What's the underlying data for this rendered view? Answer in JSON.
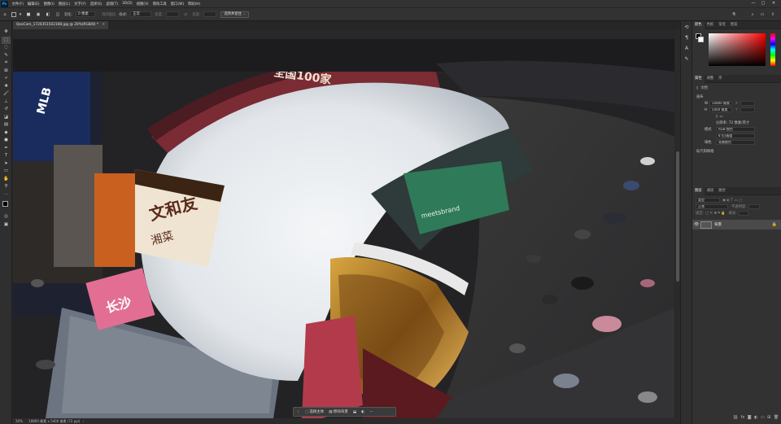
{
  "menubar": {
    "logo": "Ps",
    "items": [
      "文件(F)",
      "编辑(E)",
      "图像(I)",
      "图层(L)",
      "文字(Y)",
      "选择(S)",
      "滤镜(T)",
      "3D(D)",
      "视图(V)",
      "增效工具",
      "窗口(W)",
      "帮助(H)"
    ],
    "minimize": "—",
    "maximize": "□",
    "close": "✕"
  },
  "options": {
    "feather_label": "羽化:",
    "feather_value": "0 像素",
    "antialias_label": "消除锯齿",
    "style_label": "样式:",
    "style_value": "正常",
    "width_label": "宽度:",
    "height_label": "高度:",
    "select_subject_button": "选择并遮住 ..."
  },
  "document": {
    "tab_title": "QooCam_1720351502168.jpg @ 20%(RGB/8) *",
    "tab_close": "✕"
  },
  "status": {
    "zoom": "20%",
    "doc_info": "10800 像素 x 5400 像素 (72 ppi)",
    "arrow": "›"
  },
  "context_bar": {
    "select_subject": "选择主体",
    "remove_background": "移除背景",
    "more": "⋯"
  },
  "right_panel": {
    "color_tabs": [
      "颜色",
      "色板",
      "渐变",
      "图案"
    ],
    "properties_tabs": [
      "属性",
      "调整",
      "库"
    ],
    "doc_label": "文档",
    "canvas_section": "画布",
    "width_label": "W",
    "width_value": "10800 像素",
    "height_label": "H",
    "height_value": "5400 像素",
    "x_label": "X",
    "y_label": "Y",
    "resolution": "分辨率: 72 像素/英寸",
    "mode_label": "模式",
    "mode_value": "RGB 颜色",
    "depth_value": "8 位/通道",
    "fill_label": "填色",
    "fill_value": "背景颜色",
    "rulers_section": "标尺和网格",
    "layers_tabs": [
      "图层",
      "通道",
      "路径"
    ],
    "layer_kind": "类型",
    "blend_mode": "正常",
    "opacity_label": "不透明度:",
    "lock_label": "锁定:",
    "fill_opacity_label": "填充:",
    "layer_name": "背景"
  },
  "colors": {
    "accent": "#31a8ff",
    "panel_bg": "#323232",
    "canvas_bg": "#282828"
  },
  "photo_signs": {
    "mlb": "MLB",
    "top_banner": "全国100家",
    "restaurant_sign": "文和友",
    "restaurant_sub": "湘菜",
    "pink_sign": "长沙",
    "store_sign": "meetsbrand"
  }
}
